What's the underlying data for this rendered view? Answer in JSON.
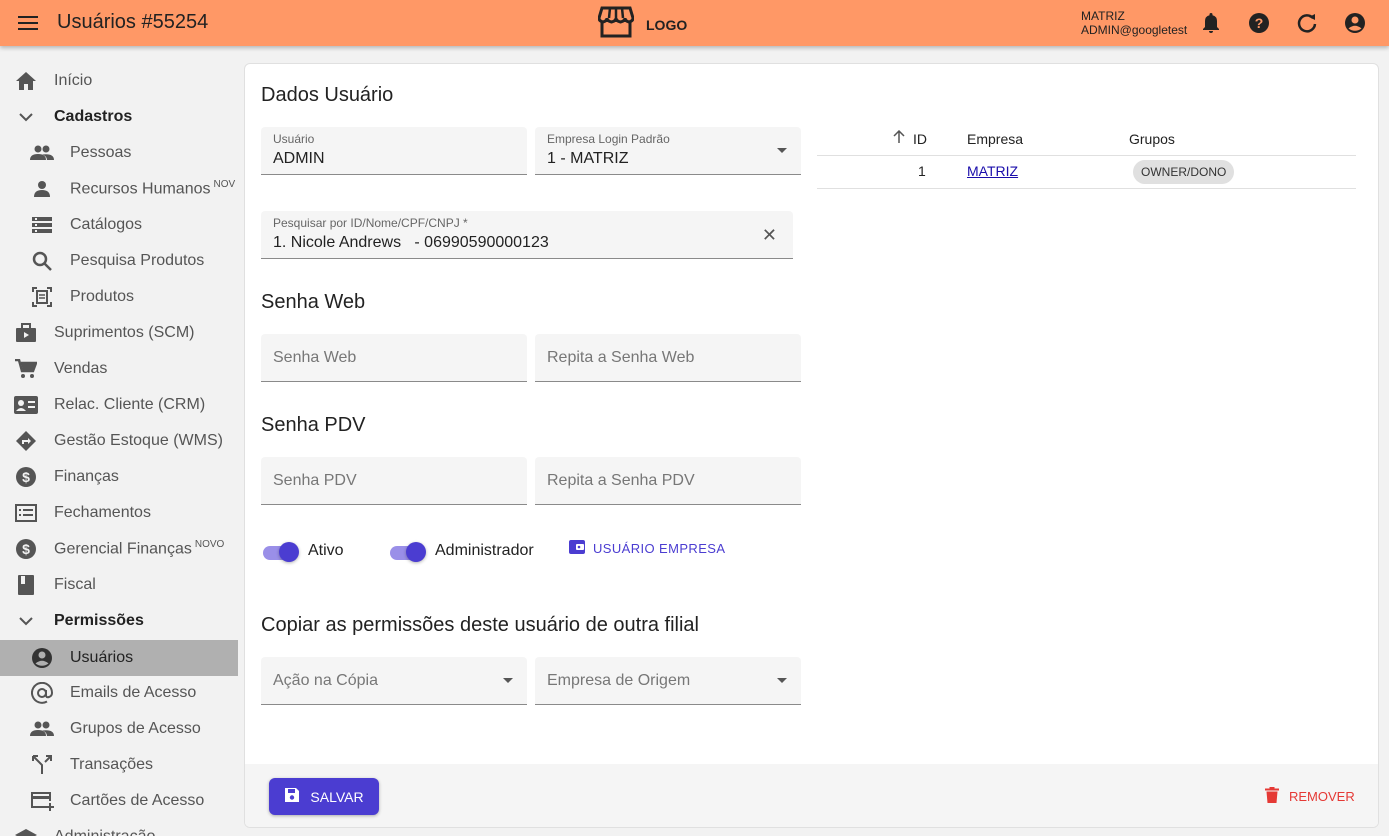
{
  "header": {
    "title": "Usuários #55254",
    "logo_text": "LOGO",
    "company": "MATRIZ",
    "user": "ADMIN@googletest",
    "icons": [
      "menu-icon",
      "store-icon",
      "bell-icon",
      "help-icon",
      "refresh-icon",
      "account-icon"
    ]
  },
  "sidebar": {
    "items": [
      {
        "label": "Início",
        "icon": "home-icon"
      },
      {
        "label": "Cadastros",
        "icon": "chevron-down-icon"
      },
      {
        "label": "Pessoas",
        "icon": "people-icon"
      },
      {
        "label": "Recursos Humanos",
        "badge": "NOV",
        "icon": "person-icon"
      },
      {
        "label": "Catálogos",
        "icon": "list-icon"
      },
      {
        "label": "Pesquisa Produtos",
        "icon": "search-icon"
      },
      {
        "label": "Produtos",
        "icon": "document-scan-icon"
      },
      {
        "label": "Suprimentos (SCM)",
        "icon": "briefcase-icon"
      },
      {
        "label": "Vendas",
        "icon": "cart-icon"
      },
      {
        "label": "Relac. Cliente (CRM)",
        "icon": "contact-card-icon"
      },
      {
        "label": "Gestão Estoque (WMS)",
        "icon": "directions-icon"
      },
      {
        "label": "Finanças",
        "icon": "dollar-icon"
      },
      {
        "label": "Fechamentos",
        "icon": "receipt-list-icon"
      },
      {
        "label": "Gerencial Finanças",
        "badge": "NOVO",
        "icon": "dollar-icon"
      },
      {
        "label": "Fiscal",
        "icon": "book-icon"
      },
      {
        "label": "Permissões",
        "icon": "chevron-down-icon"
      },
      {
        "label": "Usuários",
        "icon": "account-circle-icon"
      },
      {
        "label": "Emails de Acesso",
        "icon": "at-icon"
      },
      {
        "label": "Grupos de Acesso",
        "icon": "people-icon"
      },
      {
        "label": "Transações",
        "icon": "merge-icon"
      },
      {
        "label": "Cartões de Acesso",
        "icon": "card-add-icon"
      },
      {
        "label": "Administração",
        "icon": "school-icon"
      }
    ]
  },
  "form": {
    "section_title": "Dados Usuário",
    "usuario_label": "Usuário",
    "usuario_value": "ADMIN",
    "empresa_label": "Empresa Login Padrão",
    "empresa_value": "1 - MATRIZ",
    "pesquisa_label": "Pesquisar por ID/Nome/CPF/CNPJ *",
    "pesquisa_value": "1. Nicole Andrews   - 06990590000123",
    "senha_web_title": "Senha Web",
    "senha_web_placeholder": "Senha Web",
    "repita_web_placeholder": "Repita a Senha Web",
    "senha_pdv_title": "Senha PDV",
    "senha_pdv_placeholder": "Senha PDV",
    "repita_pdv_placeholder": "Repita a Senha PDV",
    "ativo_label": "Ativo",
    "ativo_on": true,
    "admin_label": "Administrador",
    "admin_on": true,
    "usuario_empresa_label": "USUÁRIO EMPRESA",
    "copiar_title": "Copiar as permissões deste usuário de outra filial",
    "acao_placeholder": "Ação na Cópia",
    "origem_placeholder": "Empresa de Origem"
  },
  "table": {
    "headers": {
      "id": "ID",
      "empresa": "Empresa",
      "grupos": "Grupos"
    },
    "rows": [
      {
        "id": "1",
        "empresa": "MATRIZ",
        "grupos": "OWNER/DONO"
      }
    ]
  },
  "footer": {
    "save_label": "SALVAR",
    "remove_label": "REMOVER"
  },
  "colors": {
    "header_bg": "#FF9866",
    "primary": "#4b3dd1",
    "danger": "#e53935"
  }
}
